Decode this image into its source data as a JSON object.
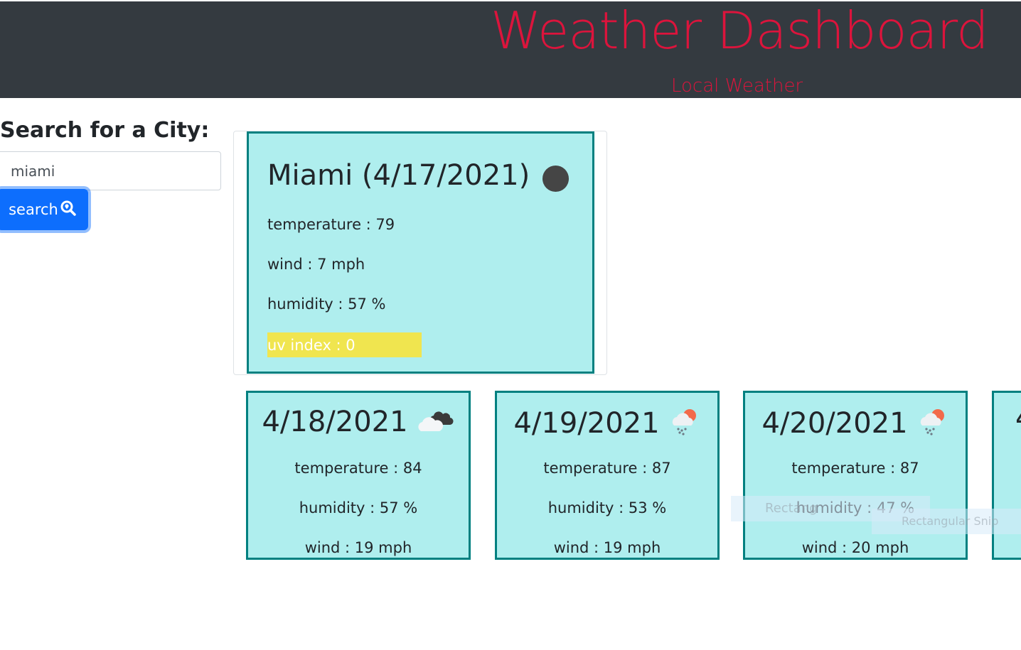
{
  "header": {
    "title": "Weather Dashboard",
    "subtitle": "Local Weather",
    "title_color": "#dc143c",
    "background": "#343a40"
  },
  "search": {
    "label": "Search for a City:",
    "value": "miami",
    "button_label": "search",
    "button_icon": "search-location-icon",
    "button_color": "#0d6efd"
  },
  "current": {
    "title": "Miami (4/17/2021)",
    "icon": "weather-dot-icon",
    "temperature": "temperature : 79",
    "wind": "wind : 7 mph",
    "humidity": "humidity : 57 %",
    "uv": "uv index : 0",
    "uv_color": "#f0e54f",
    "card_color": "#afeeee",
    "border_color": "#008080"
  },
  "forecast": [
    {
      "date": "4/18/2021",
      "icon": "clouds-icon",
      "temperature": "temperature : 84",
      "humidity": "humidity : 57 %",
      "wind": "wind : 19 mph"
    },
    {
      "date": "4/19/2021",
      "icon": "sun-rain-cloud-icon",
      "temperature": "temperature : 87",
      "humidity": "humidity : 53 %",
      "wind": "wind : 19 mph"
    },
    {
      "date": "4/20/2021",
      "icon": "sun-rain-cloud-icon",
      "temperature": "temperature : 87",
      "humidity": "humidity : 47 %",
      "wind": "wind : 20 mph"
    },
    {
      "date": "4",
      "icon": "",
      "temperature": "",
      "humidity": "",
      "wind": ""
    }
  ],
  "overlays": {
    "ghost_1": "Rectang",
    "ghost_2": "Rectangular Snip"
  }
}
